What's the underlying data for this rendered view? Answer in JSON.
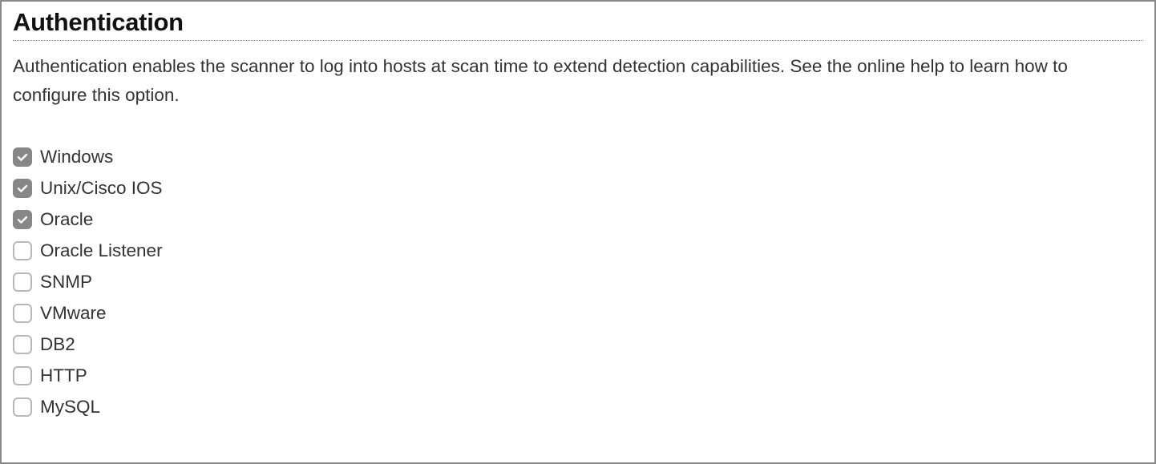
{
  "section": {
    "title": "Authentication",
    "description": "Authentication enables the scanner to log into hosts at scan time to extend detection capabilities. See the online help to learn how to configure this option."
  },
  "options": [
    {
      "label": "Windows",
      "checked": true
    },
    {
      "label": "Unix/Cisco IOS",
      "checked": true
    },
    {
      "label": "Oracle",
      "checked": true
    },
    {
      "label": "Oracle Listener",
      "checked": false
    },
    {
      "label": "SNMP",
      "checked": false
    },
    {
      "label": "VMware",
      "checked": false
    },
    {
      "label": "DB2",
      "checked": false
    },
    {
      "label": "HTTP",
      "checked": false
    },
    {
      "label": "MySQL",
      "checked": false
    }
  ]
}
